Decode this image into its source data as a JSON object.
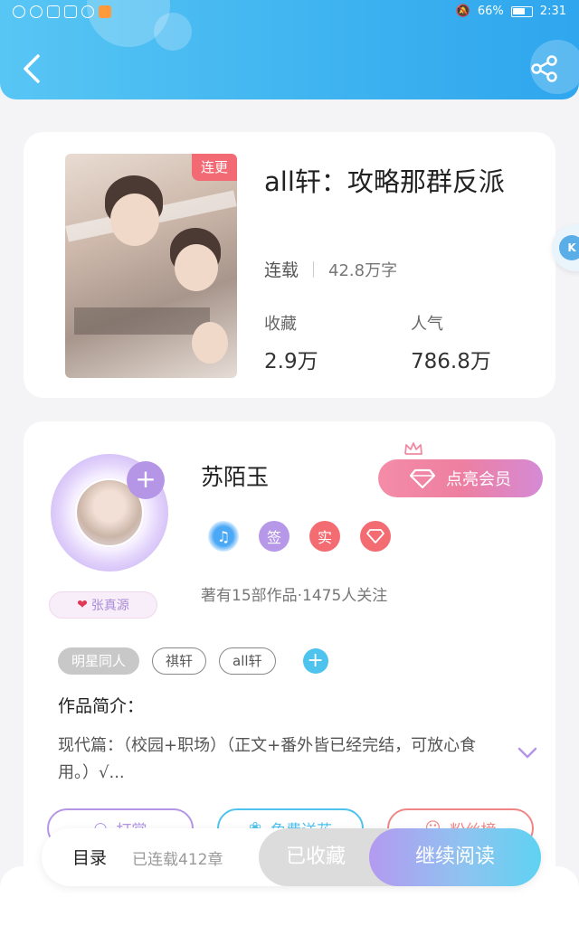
{
  "status_bar": {
    "battery": "66%",
    "time": "2:31"
  },
  "header": {
    "back_icon": "chevron-left-icon",
    "share_icon": "share-icon",
    "color_start": "#58c6f4",
    "color_end": "#2fa6ee"
  },
  "side_handle": {
    "label": "K"
  },
  "book": {
    "badge": "连更",
    "title": "all轩：攻略那群反派",
    "status": "连载",
    "words": "42.8万字",
    "favorites_label": "收藏",
    "favorites_value": "2.9万",
    "popularity_label": "人气",
    "popularity_value": "786.8万"
  },
  "author": {
    "name": "苏陌玉",
    "fan_tag": "张真源",
    "vip_button": "点亮会员",
    "badges": {
      "sign": "签",
      "real": "实"
    },
    "stats": "著有15部作品·1475人关注"
  },
  "tags": [
    "明星同人",
    "祺轩",
    "all轩"
  ],
  "intro": {
    "title": "作品简介：",
    "text": "现代篇：（校园+职场）（正文+番外皆已经完结，可放心食用。）√..."
  },
  "actions": {
    "reward": "打赏",
    "flower": "免费送花",
    "fans": "粉丝榜"
  },
  "bottom_bar": {
    "toc": "目录",
    "chapters": "已连载412章",
    "favorited": "已收藏",
    "continue_reading": "继续阅读"
  }
}
